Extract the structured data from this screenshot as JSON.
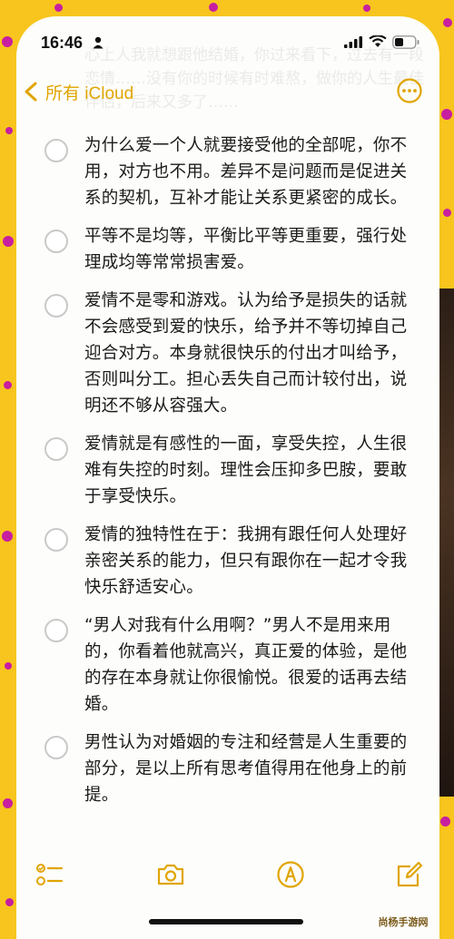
{
  "status_bar": {
    "time": "16:46"
  },
  "nav": {
    "back_label": "所有 iCloud"
  },
  "ghost_text": "心上人我就想跟他结婚，你过来看下，过去有一段恋情……没有你的时候有时难熬，做你的人生最佳伴侣，后来又多了……",
  "checklist": [
    {
      "text": "为什么爱一个人就要接受他的全部呢，你不用，对方也不用。差异不是问题而是促进关系的契机，互补才能让关系更紧密的成长。",
      "checked": false
    },
    {
      "text": "平等不是均等，平衡比平等更重要，强行处理成均等常常损害爱。",
      "checked": false
    },
    {
      "text": "爱情不是零和游戏。认为给予是损失的话就不会感受到爱的快乐，给予并不等切掉自己迎合对方。本身就很快乐的付出才叫给予，否则叫分工。担心丢失自己而计较付出，说明还不够从容强大。",
      "checked": false
    },
    {
      "text": "爱情就是有感性的一面，享受失控，人生很难有失控的时刻。理性会压抑多巴胺，要敢于享受快乐。",
      "checked": false
    },
    {
      "text": "爱情的独特性在于：我拥有跟任何人处理好亲密关系的能力，但只有跟你在一起才令我快乐舒适安心。",
      "checked": false
    },
    {
      "text": "“男人对我有什么用啊？”男人不是用来用的，你看着他就高兴，真正爱的体验，是他的存在本身就让你很愉悦。很爱的话再去结婚。",
      "checked": false
    },
    {
      "text": "男性认为对婚姻的专注和经营是人生重要的部分，是以上所有思考值得用在他身上的前提。",
      "checked": false
    }
  ],
  "watermark": "尚杨手游网",
  "colors": {
    "accent": "#e0a500",
    "frame": "#f7c51d",
    "dots": "#c81ea0"
  }
}
